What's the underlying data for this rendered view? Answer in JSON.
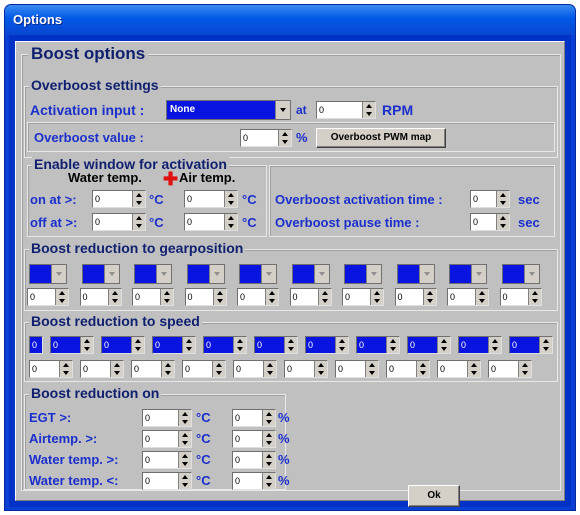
{
  "window": {
    "title": "Options"
  },
  "boost_options": {
    "title": "Boost options"
  },
  "overboost": {
    "group_title": "Overboost settings",
    "activation_label": "Activation input :",
    "activation_value": "None",
    "at_label": "at",
    "rpm_value": "0",
    "rpm_unit": "RPM",
    "value_label": "Overboost value :",
    "value": "0",
    "value_unit": "%",
    "pwm_button": "Overboost PWM map"
  },
  "enable_window": {
    "group_title": "Enable window for activation",
    "water_header": "Water temp.",
    "plus": "✚",
    "air_header": "Air temp.",
    "on_label": "on at >:",
    "off_label": "off at >:",
    "on_water": "0",
    "on_air": "0",
    "off_water": "0",
    "off_air": "0",
    "unit": "°C",
    "activation_time_label": "Overboost activation time :",
    "activation_time_value": "0",
    "pause_time_label": "Overboost pause time :",
    "pause_time_value": "0",
    "sec": "sec"
  },
  "gear": {
    "group_title": "Boost reduction to gearposition",
    "values": [
      "0",
      "0",
      "0",
      "0",
      "0",
      "0",
      "0",
      "0",
      "0",
      "0"
    ]
  },
  "speed": {
    "group_title": "Boost reduction to speed",
    "first_value": "0",
    "top_values": [
      "0",
      "0",
      "0",
      "0",
      "0",
      "0",
      "0",
      "0",
      "0",
      "0"
    ],
    "bottom_values": [
      "0",
      "0",
      "0",
      "0",
      "0",
      "0",
      "0",
      "0",
      "0",
      "0"
    ]
  },
  "reduction_on": {
    "group_title": "Boost reduction on",
    "rows": [
      {
        "label": "EGT >:",
        "temp": "0",
        "pct": "0"
      },
      {
        "label": "Airtemp. >:",
        "temp": "0",
        "pct": "0"
      },
      {
        "label": "Water temp. >:",
        "temp": "0",
        "pct": "0"
      },
      {
        "label": "Water temp. <:",
        "temp": "0",
        "pct": "0"
      }
    ],
    "unit_temp": "°C",
    "unit_pct": "%"
  },
  "ok_button": "Ok",
  "colors": {
    "title_bar": "#0058e6",
    "field_blue": "#0a14e0",
    "label_blue": "#1b2fcc",
    "panel": "#c0c0c0"
  }
}
